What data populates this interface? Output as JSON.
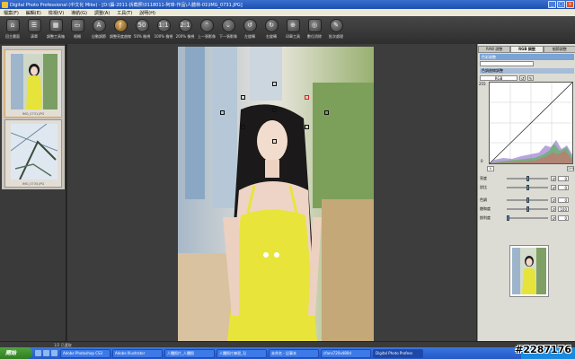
{
  "window": {
    "title": "Digital Photo Professional (中文化 Mike) - [D:\\攝-2011-拆截照\\0118011-阿瑋-作品\\人體林-01\\IMG_0731.JPG]",
    "buttons": [
      "_",
      "□",
      "×"
    ]
  },
  "menubar": {
    "items": [
      "檔案(F)",
      "編輯(E)",
      "檢視(V)",
      "導航(G)",
      "調整(A)",
      "工具(T)",
      "說明(H)"
    ]
  },
  "toolbar": {
    "items": [
      {
        "label": "回主畫面",
        "icon": "home-icon"
      },
      {
        "label": "清單",
        "icon": "list-icon"
      },
      {
        "label": "調整工具箱",
        "icon": "toolbox-icon"
      },
      {
        "label": "格柵",
        "icon": "grid-icon"
      },
      {
        "label": "自動調節",
        "icon": "auto-icon"
      },
      {
        "label": "調整亮度曲線",
        "icon": "curve-icon"
      },
      {
        "label": "50% 檢視",
        "icon": "zoom50-icon"
      },
      {
        "label": "100% 檢視",
        "icon": "zoom100-icon"
      },
      {
        "label": "200% 檢視",
        "icon": "zoom200-icon"
      },
      {
        "label": "上一張影像",
        "icon": "prev-image-icon"
      },
      {
        "label": "下一張影像",
        "icon": "next-image-icon"
      },
      {
        "label": "左旋轉",
        "icon": "rotate-left-icon"
      },
      {
        "label": "右旋轉",
        "icon": "rotate-right-icon"
      },
      {
        "label": "印章工具",
        "icon": "stamp-icon"
      },
      {
        "label": "數位消除",
        "icon": "dust-icon"
      },
      {
        "label": "批次處理",
        "icon": "batch-icon"
      }
    ]
  },
  "thumbnails": [
    {
      "caption": "IMG_0731.JPG",
      "selected": true
    },
    {
      "caption": "IMG_0735.JPG",
      "selected": false
    }
  ],
  "right_panel": {
    "tabs": [
      "RAW 調整",
      "RGB 調整",
      "細節調整"
    ],
    "active_tab": "RGB 調整",
    "subheading": "色彩調整",
    "dropdown_value": "",
    "curve_section": "色調曲線調整",
    "curve_mode": "RGB",
    "graph_max": "255",
    "graph_min": "0",
    "x_min": "0",
    "x_max": "255",
    "sliders": [
      {
        "label": "亮度",
        "value": "0",
        "level": 0.5
      },
      {
        "label": "對比",
        "value": "0",
        "level": 0.5
      },
      {
        "label": "色調",
        "value": "0",
        "level": 0.5
      },
      {
        "label": "飽和度",
        "value": "100",
        "level": 0.5
      },
      {
        "label": "銳利度",
        "value": "0",
        "level": 0.0
      }
    ]
  },
  "statusbar": {
    "text": "1/2 已選取"
  },
  "taskbar": {
    "start": "開始",
    "tasks": [
      {
        "label": "Adobe Photoshop CS3",
        "active": false
      },
      {
        "label": "Adobe Illustrator",
        "active": false
      },
      {
        "label": "人體照片_人體照",
        "active": false
      },
      {
        "label": "人體照片練習_1J",
        "active": false
      },
      {
        "label": "未命名 - 記事本",
        "active": false
      },
      {
        "label": "cfans720x480d",
        "active": false
      },
      {
        "label": "Digital Photo Profess",
        "active": true
      }
    ]
  },
  "watermark": "#2287176"
}
